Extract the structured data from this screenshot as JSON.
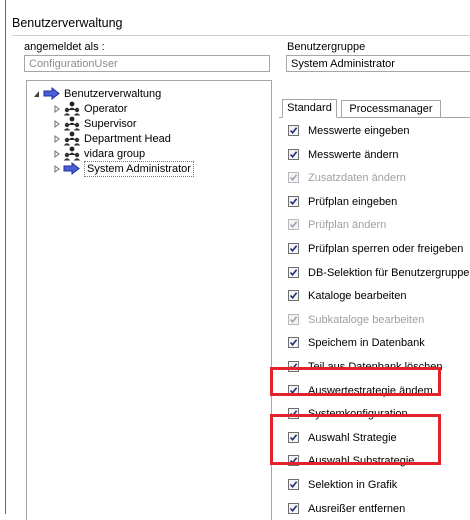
{
  "window": {
    "title": "Benutzerverwaltung"
  },
  "login": {
    "label": "angemeldet als :",
    "value": "ConfigurationUser"
  },
  "group": {
    "label": "Benutzergruppe",
    "value": "System Administrator"
  },
  "tree": {
    "root": "Benutzerverwaltung",
    "children": [
      "Operator",
      "Supervisor",
      "Department Head",
      "vidara group",
      "System Administrator"
    ]
  },
  "tabs": [
    "Standard",
    "Processmanager"
  ],
  "permissions": [
    {
      "label": "Messwerte eingeben",
      "checked": true,
      "enabled": true
    },
    {
      "label": "Messwerte ändern",
      "checked": true,
      "enabled": true
    },
    {
      "label": "Zusatzdaten ändern",
      "checked": true,
      "enabled": false
    },
    {
      "label": "Prüfplan eingeben",
      "checked": true,
      "enabled": true
    },
    {
      "label": "Prüfplan ändern",
      "checked": true,
      "enabled": false
    },
    {
      "label": "Prüfplan sperren oder freigeben",
      "checked": true,
      "enabled": true
    },
    {
      "label": "DB-Selektion für Benutzergruppen",
      "checked": true,
      "enabled": true
    },
    {
      "label": "Kataloge bearbeiten",
      "checked": true,
      "enabled": true
    },
    {
      "label": "Subkataloge bearbeiten",
      "checked": true,
      "enabled": false
    },
    {
      "label": "Speichem in Datenbank",
      "checked": true,
      "enabled": true
    },
    {
      "label": "Teil aus Datenbank löschen",
      "checked": true,
      "enabled": true
    },
    {
      "label": "Auswertestrategie ändem",
      "checked": true,
      "enabled": true
    },
    {
      "label": "Systemkonfiguration",
      "checked": true,
      "enabled": true
    },
    {
      "label": "Auswahl Strategie",
      "checked": true,
      "enabled": true
    },
    {
      "label": "Auswahl Substrategie",
      "checked": true,
      "enabled": true
    },
    {
      "label": "Selektion in Grafik",
      "checked": true,
      "enabled": true
    },
    {
      "label": "Ausreißer entfernen",
      "checked": true,
      "enabled": true
    }
  ],
  "colors": {
    "highlight": "#e3232b",
    "border": "#a6a6a6",
    "disabled_text": "#a0a0a0"
  }
}
